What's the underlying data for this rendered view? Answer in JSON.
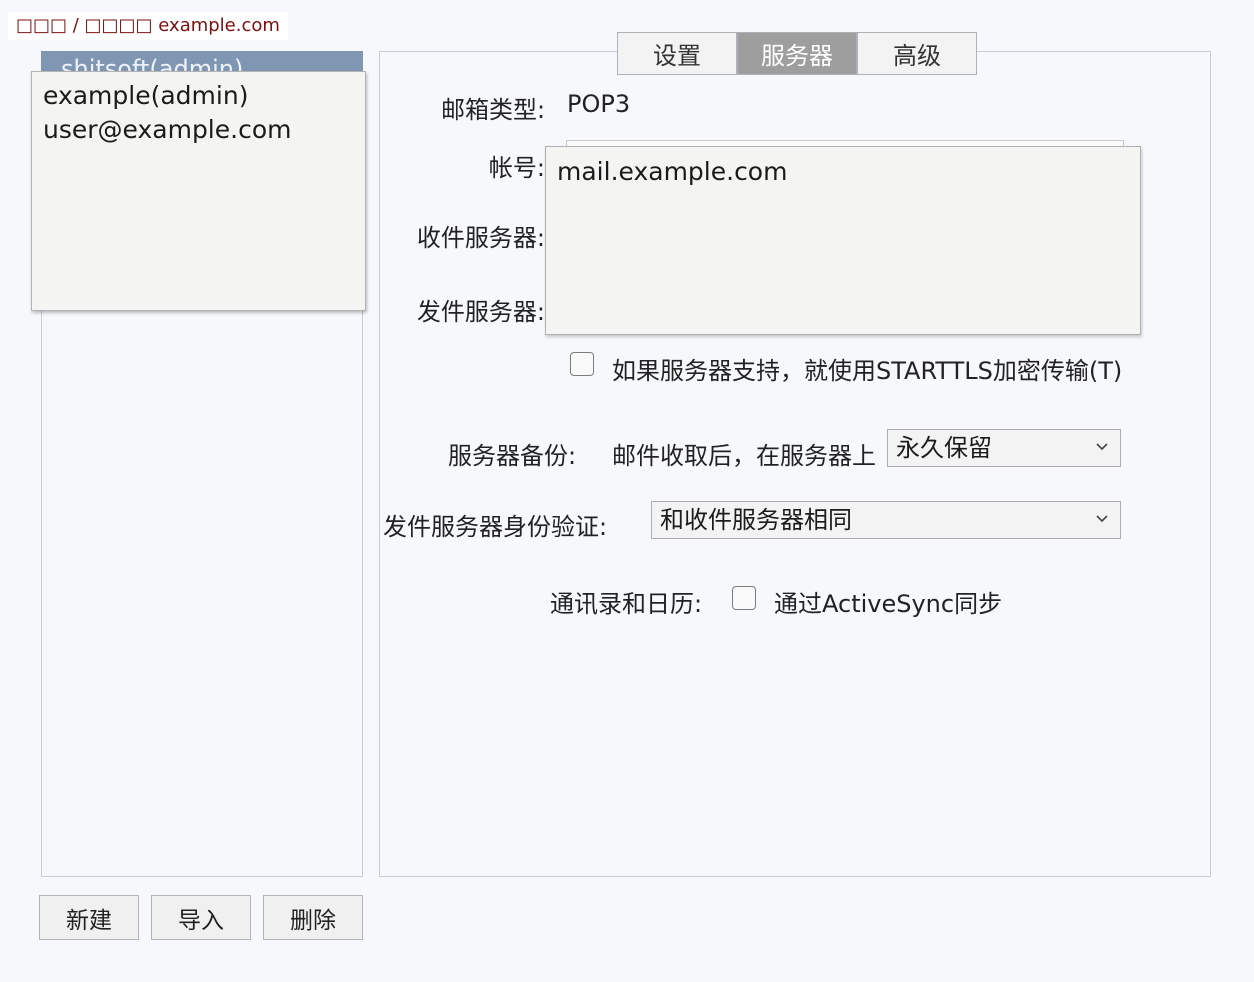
{
  "breadcrumb": "□□□ / □□□□ example.com",
  "accounts": {
    "header_text": "shitsoft(admin)",
    "list_items": [
      "example(admin)",
      "user@example.com"
    ],
    "buttons": {
      "new": "新建",
      "import": "导入",
      "delete": "删除"
    }
  },
  "tabs": [
    {
      "label": "设置",
      "active": false
    },
    {
      "label": "服务器",
      "active": true
    },
    {
      "label": "高级",
      "active": false
    }
  ],
  "form": {
    "mailbox_type_label": "邮箱类型:",
    "mailbox_type_value": "POP3",
    "account_label": "帐号:",
    "incoming_server_label": "收件服务器:",
    "outgoing_server_label": "发件服务器:",
    "server_suggestion": "mail.example.com",
    "starttls_label": "如果服务器支持，就使用STARTTLS加密传输(T)",
    "starttls_checked": false,
    "backup_label": "服务器备份:",
    "backup_prefix": "邮件收取后，在服务器上",
    "backup_value": "永久保留",
    "outgoing_auth_label": "发件服务器身份验证:",
    "outgoing_auth_value": "和收件服务器相同",
    "contacts_label": "通讯录和日历:",
    "activesync_label": "通过ActiveSync同步",
    "activesync_checked": false
  },
  "icons": {
    "select_arrow": "chevron-down-icon"
  },
  "colors": {
    "selected_tab": "#9e9e9e",
    "account_header": "#7f97b3",
    "breadcrumb_text": "#7a1010"
  }
}
